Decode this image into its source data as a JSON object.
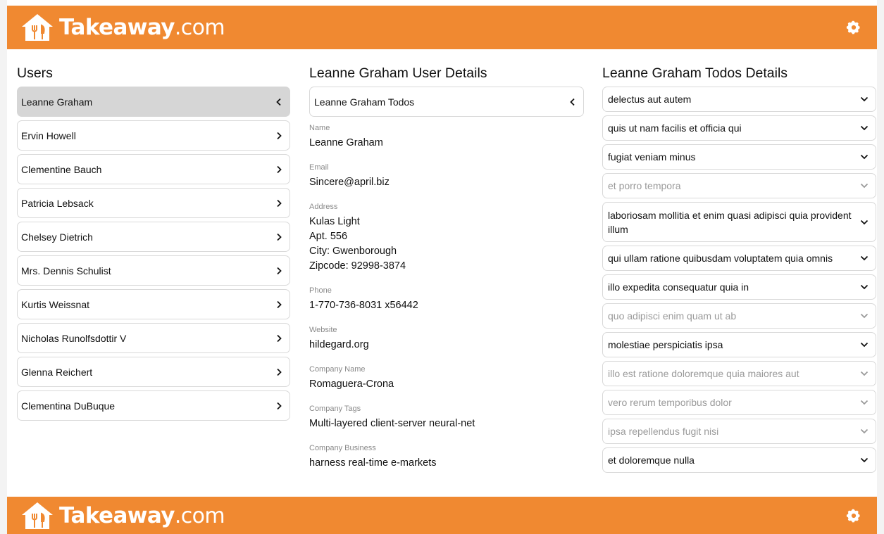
{
  "brand": {
    "name": "Takeaway",
    "suffix": ".com",
    "color": "#f08931"
  },
  "users_panel": {
    "title": "Users",
    "items": [
      {
        "label": "Leanne Graham",
        "active": true
      },
      {
        "label": "Ervin Howell"
      },
      {
        "label": "Clementine Bauch"
      },
      {
        "label": "Patricia Lebsack"
      },
      {
        "label": "Chelsey Dietrich"
      },
      {
        "label": "Mrs. Dennis Schulist"
      },
      {
        "label": "Kurtis Weissnat"
      },
      {
        "label": "Nicholas Runolfsdottir V"
      },
      {
        "label": "Glenna Reichert"
      },
      {
        "label": "Clementina DuBuque"
      }
    ]
  },
  "details_panel": {
    "title": "Leanne Graham User Details",
    "todos_link": "Leanne Graham Todos",
    "fields": {
      "name": {
        "label": "Name",
        "value": "Leanne Graham"
      },
      "email": {
        "label": "Email",
        "value": "Sincere@april.biz"
      },
      "address": {
        "label": "Address",
        "street": "Kulas Light",
        "suite": "Apt. 556",
        "city": "City: Gwenborough",
        "zip": "Zipcode: 92998-3874"
      },
      "phone": {
        "label": "Phone",
        "value": "1-770-736-8031 x56442"
      },
      "website": {
        "label": "Website",
        "value": "hildegard.org"
      },
      "company_name": {
        "label": "Company Name",
        "value": "Romaguera-Crona"
      },
      "company_tags": {
        "label": "Company Tags",
        "value": "Multi-layered client-server neural-net"
      },
      "company_business": {
        "label": "Company Business",
        "value": "harness real-time e-markets"
      }
    }
  },
  "todos_panel": {
    "title": "Leanne Graham Todos Details",
    "items": [
      {
        "label": "delectus aut autem",
        "completed": false
      },
      {
        "label": "quis ut nam facilis et officia qui",
        "completed": false
      },
      {
        "label": "fugiat veniam minus",
        "completed": false
      },
      {
        "label": "et porro tempora",
        "completed": true
      },
      {
        "label": "laboriosam mollitia et enim quasi adipisci quia provident illum",
        "completed": false
      },
      {
        "label": "qui ullam ratione quibusdam voluptatem quia omnis",
        "completed": false
      },
      {
        "label": "illo expedita consequatur quia in",
        "completed": false
      },
      {
        "label": "quo adipisci enim quam ut ab",
        "completed": true
      },
      {
        "label": "molestiae perspiciatis ipsa",
        "completed": false
      },
      {
        "label": "illo est ratione doloremque quia maiores aut",
        "completed": true
      },
      {
        "label": "vero rerum temporibus dolor",
        "completed": true
      },
      {
        "label": "ipsa repellendus fugit nisi",
        "completed": true
      },
      {
        "label": "et doloremque nulla",
        "completed": false
      }
    ]
  },
  "icons": {
    "settings": "gear-icon",
    "logo": "house-fork-knife-logo",
    "open": "chevron-right-icon",
    "back": "chevron-left-icon",
    "expand": "chevron-down-icon"
  }
}
